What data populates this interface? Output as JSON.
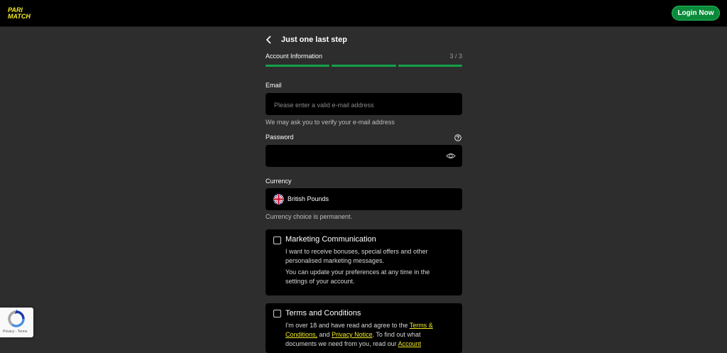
{
  "header": {
    "logo_line1": "PARI",
    "logo_line2": "MATCH",
    "login_label": "Login Now"
  },
  "form": {
    "title": "Just one last step",
    "step_name": "Account Information",
    "step_count": "3 / 3",
    "email": {
      "label": "Email",
      "placeholder": "Please enter a valid e-mail address",
      "hint": "We may ask you to verify your e-mail address"
    },
    "password": {
      "label": "Password"
    },
    "currency": {
      "label": "Currency",
      "value": "British Pounds",
      "hint": "Currency choice is permanent."
    },
    "marketing": {
      "title": "Marketing Communication",
      "text1": "I want to receive bonuses, special offers and other personalised marketing messages.",
      "text2": "You can update your preferences at any time in the settings of your account."
    },
    "terms": {
      "title": "Terms and Conditions",
      "text_pre": "I'm over 18 and have read and agree to the ",
      "link_terms": "Terms & Conditions,",
      "text_mid": " and ",
      "link_privacy": "Privacy Notice",
      "text_post": ". To find out what documents we need from you, read our ",
      "link_account": "Account"
    }
  },
  "recaptcha": {
    "links": "Privacy - Terms"
  },
  "colors": {
    "accent_green": "#13a04a",
    "brand_yellow": "#f2ea24",
    "background": "#2d2d2d"
  }
}
